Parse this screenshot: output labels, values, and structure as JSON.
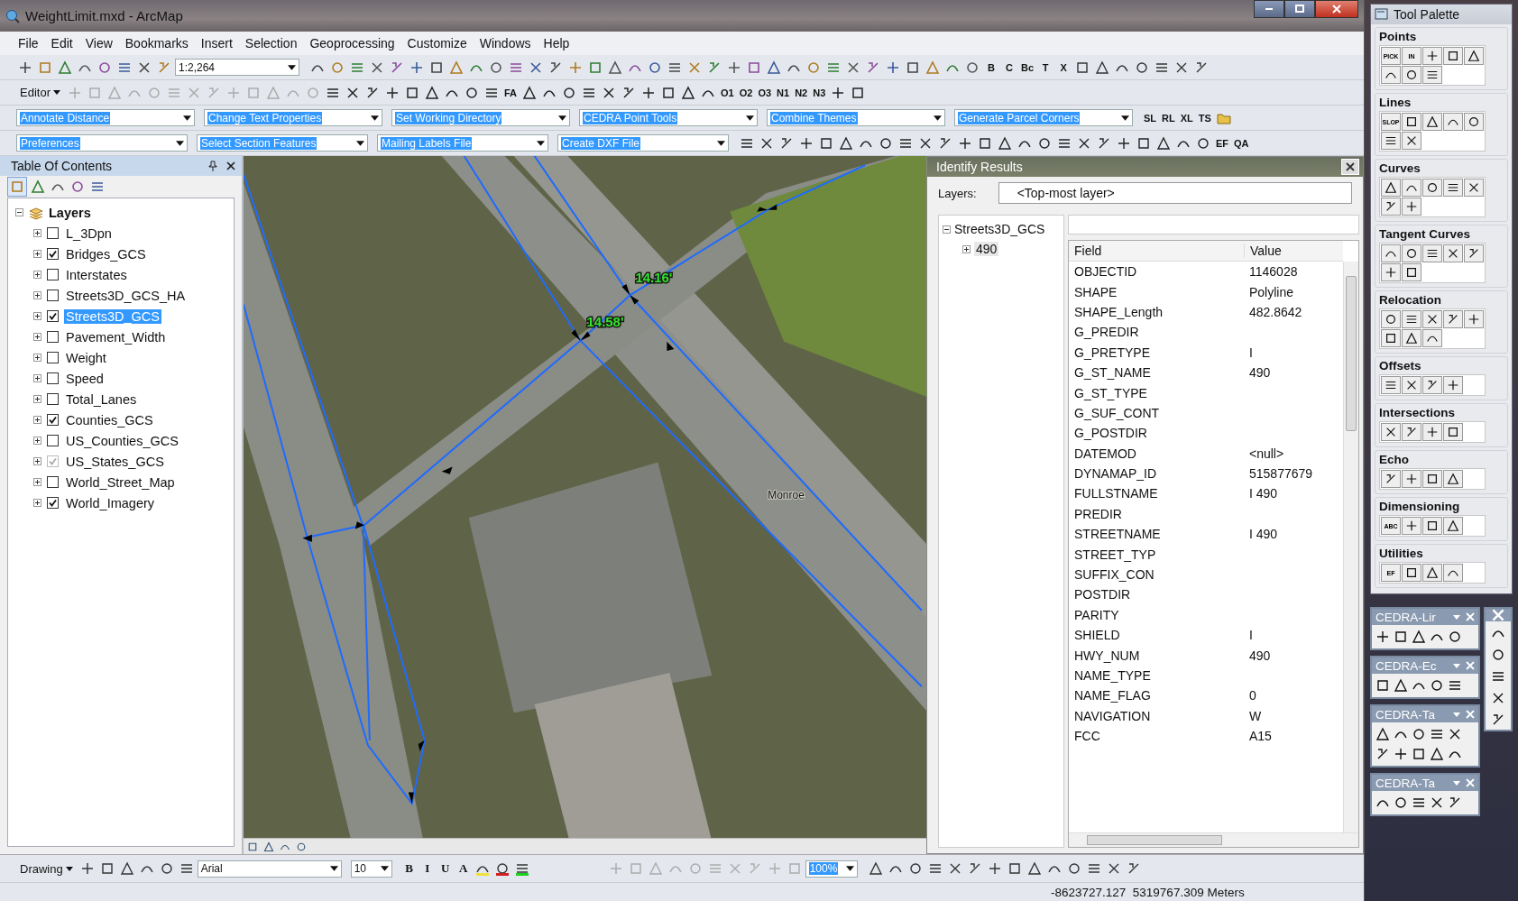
{
  "window": {
    "title": "WeightLimit.mxd - ArcMap"
  },
  "menu": [
    "File",
    "Edit",
    "View",
    "Bookmarks",
    "Insert",
    "Selection",
    "Geoprocessing",
    "Customize",
    "Windows",
    "Help"
  ],
  "toolbar_row_1": {
    "scale": "1:2,264",
    "text_tools": [
      "B",
      "C",
      "Bc",
      "T",
      "X"
    ]
  },
  "toolbar_row_2": {
    "editor": "Editor",
    "text_tools": [
      "FA"
    ],
    "code_tools": [
      "O1",
      "O2",
      "O3",
      "N1",
      "N2",
      "N3"
    ]
  },
  "toolbar_row_3": {
    "combos": [
      {
        "label": "Annotate Distance"
      },
      {
        "label": "Change Text Properties"
      },
      {
        "label": "Set Working Directory"
      },
      {
        "label": "CEDRA Point Tools"
      },
      {
        "label": "Combine Themes"
      },
      {
        "label": "Generate Parcel Corners"
      }
    ],
    "text_tools": [
      "SL",
      "RL",
      "XL",
      "TS"
    ]
  },
  "toolbar_row_4": {
    "combos": [
      {
        "label": "Preferences"
      },
      {
        "label": "Select Section Features"
      },
      {
        "label": "Mailing Labels File"
      },
      {
        "label": "Create DXF File"
      }
    ],
    "text_tools": [
      "EF",
      "QA"
    ]
  },
  "toc": {
    "title": "Table Of Contents",
    "root": "Layers",
    "layers": [
      {
        "name": "L_3Dpn",
        "checked": false,
        "dimmed": false,
        "selected": false
      },
      {
        "name": "Bridges_GCS",
        "checked": true,
        "dimmed": false,
        "selected": false
      },
      {
        "name": "Interstates",
        "checked": false,
        "dimmed": false,
        "selected": false
      },
      {
        "name": "Streets3D_GCS_HA",
        "checked": false,
        "dimmed": false,
        "selected": false
      },
      {
        "name": "Streets3D_GCS",
        "checked": true,
        "dimmed": false,
        "selected": true
      },
      {
        "name": "Pavement_Width",
        "checked": false,
        "dimmed": false,
        "selected": false
      },
      {
        "name": "Weight",
        "checked": false,
        "dimmed": false,
        "selected": false
      },
      {
        "name": "Speed",
        "checked": false,
        "dimmed": false,
        "selected": false
      },
      {
        "name": "Total_Lanes",
        "checked": false,
        "dimmed": false,
        "selected": false
      },
      {
        "name": "Counties_GCS",
        "checked": true,
        "dimmed": false,
        "selected": false
      },
      {
        "name": "US_Counties_GCS",
        "checked": false,
        "dimmed": false,
        "selected": false
      },
      {
        "name": "US_States_GCS",
        "checked": true,
        "dimmed": true,
        "selected": false
      },
      {
        "name": "World_Street_Map",
        "checked": false,
        "dimmed": false,
        "selected": false
      },
      {
        "name": "World_Imagery",
        "checked": true,
        "dimmed": false,
        "selected": false
      }
    ]
  },
  "map": {
    "labels": [
      {
        "text": "14.16'",
        "kind": "measure"
      },
      {
        "text": "14.58'",
        "kind": "measure"
      },
      {
        "text": "Monroe",
        "kind": "street"
      }
    ]
  },
  "identify": {
    "title": "Identify Results",
    "layers_label": "Layers:",
    "layers_value": "<Top-most layer>",
    "tree": [
      {
        "label": "Streets3D_GCS",
        "expanded": true,
        "children": [
          {
            "label": "490",
            "expanded": false
          }
        ]
      }
    ],
    "columns": [
      "Field",
      "Value"
    ],
    "rows": [
      {
        "field": "OBJECTID",
        "value": "1146028"
      },
      {
        "field": "SHAPE",
        "value": "Polyline"
      },
      {
        "field": "SHAPE_Length",
        "value": "482.8642"
      },
      {
        "field": "G_PREDIR"
      },
      {
        "field": "G_PRETYPE",
        "value": "I"
      },
      {
        "field": "G_ST_NAME",
        "value": "490"
      },
      {
        "field": "G_ST_TYPE"
      },
      {
        "field": "G_SUF_CONT"
      },
      {
        "field": "G_POSTDIR"
      },
      {
        "field": "DATEMOD",
        "value": "<null>"
      },
      {
        "field": "DYNAMAP_ID",
        "value": "515877679"
      },
      {
        "field": "FULLSTNAME",
        "value": "I 490"
      },
      {
        "field": "PREDIR"
      },
      {
        "field": "STREETNAME",
        "value": "I 490"
      },
      {
        "field": "STREET_TYP"
      },
      {
        "field": "SUFFIX_CON"
      },
      {
        "field": "POSTDIR"
      },
      {
        "field": "PARITY"
      },
      {
        "field": "SHIELD",
        "value": "I"
      },
      {
        "field": "HWY_NUM",
        "value": "490"
      },
      {
        "field": "NAME_TYPE"
      },
      {
        "field": "NAME_FLAG",
        "value": "0"
      },
      {
        "field": "NAVIGATION",
        "value": "W"
      },
      {
        "field": "FCC",
        "value": "A15"
      }
    ]
  },
  "drawing_toolbar": {
    "drawing": "Drawing",
    "font": "Arial",
    "size": "10",
    "zoom": "100%",
    "text_tools": [
      "B",
      "I",
      "U",
      "A"
    ]
  },
  "status_bar": {
    "coordinates": "-8623727.127  5319767.309 Meters"
  },
  "tool_palette": {
    "title": "Tool Palette",
    "groups": [
      {
        "name": "Points",
        "text_tools": [
          "PICK",
          "IN"
        ]
      },
      {
        "name": "Lines",
        "text_tools": [
          "SLOP"
        ]
      },
      {
        "name": "Curves"
      },
      {
        "name": "Tangent Curves"
      },
      {
        "name": "Relocation"
      },
      {
        "name": "Offsets"
      },
      {
        "name": "Intersections"
      },
      {
        "name": "Echo"
      },
      {
        "name": "Dimensioning",
        "text_tools": [
          "ABC"
        ]
      },
      {
        "name": "Utilities",
        "text_tools": [
          "EF"
        ]
      }
    ]
  },
  "mini_toolbars": [
    {
      "title": "CEDRA-Lir"
    },
    {
      "title": "CEDRA-Ec"
    },
    {
      "title": "CEDRA-Ta"
    },
    {
      "title": "CEDRA-Ta"
    }
  ]
}
